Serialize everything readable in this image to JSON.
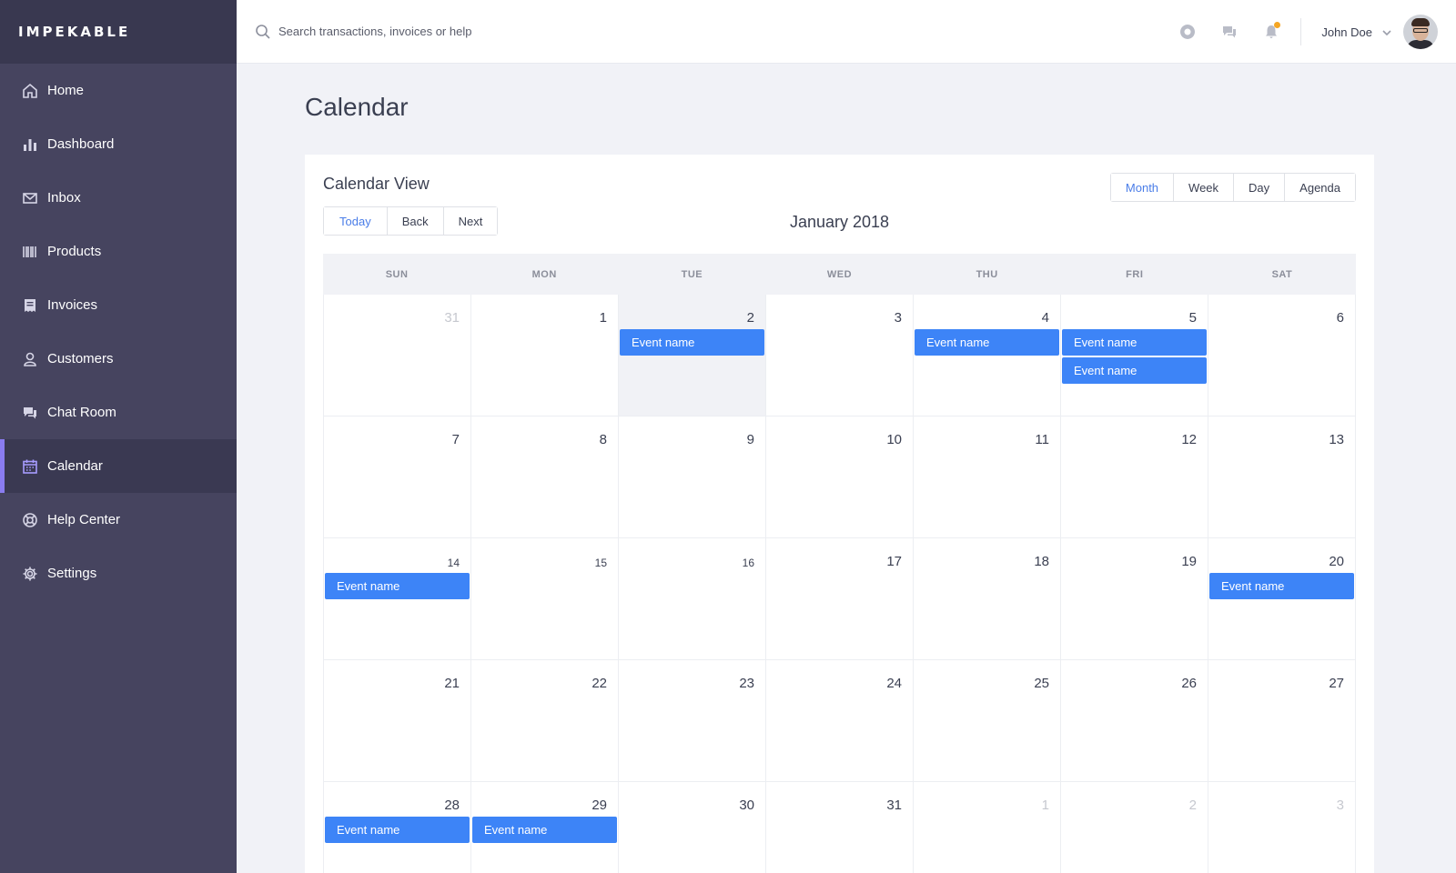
{
  "brand": "IMPEKABLE",
  "sidebar": {
    "items": [
      {
        "label": "Home"
      },
      {
        "label": "Dashboard"
      },
      {
        "label": "Inbox"
      },
      {
        "label": "Products"
      },
      {
        "label": "Invoices"
      },
      {
        "label": "Customers"
      },
      {
        "label": "Chat Room"
      },
      {
        "label": "Calendar",
        "active": true
      },
      {
        "label": "Help Center"
      },
      {
        "label": "Settings"
      }
    ]
  },
  "header": {
    "search_placeholder": "Search transactions, invoices or help",
    "user_name": "John Doe"
  },
  "page": {
    "title": "Calendar"
  },
  "calendar": {
    "card_title": "Calendar View",
    "nav_buttons": [
      "Today",
      "Back",
      "Next"
    ],
    "view_buttons": [
      "Month",
      "Week",
      "Day",
      "Agenda"
    ],
    "active_view": "Month",
    "month_label": "January 2018",
    "weekdays": [
      "SUN",
      "MON",
      "TUE",
      "WED",
      "THU",
      "FRI",
      "SAT"
    ],
    "weeks": [
      [
        {
          "day": "31",
          "off": true,
          "events": []
        },
        {
          "day": "1",
          "events": []
        },
        {
          "day": "2",
          "today": true,
          "events": [
            "Event name"
          ]
        },
        {
          "day": "3",
          "events": []
        },
        {
          "day": "4",
          "events": [
            "Event name"
          ]
        },
        {
          "day": "5",
          "events": [
            "Event name",
            "Event name"
          ]
        },
        {
          "day": "6",
          "events": []
        }
      ],
      [
        {
          "day": "7",
          "events": []
        },
        {
          "day": "8",
          "events": []
        },
        {
          "day": "9",
          "events": []
        },
        {
          "day": "10",
          "events": []
        },
        {
          "day": "11",
          "events": []
        },
        {
          "day": "12",
          "events": []
        },
        {
          "day": "13",
          "events": []
        }
      ],
      [
        {
          "day": "14",
          "small": true,
          "events": [
            "Event name"
          ]
        },
        {
          "day": "15",
          "small": true,
          "events": []
        },
        {
          "day": "16",
          "small": true,
          "events": []
        },
        {
          "day": "17",
          "events": []
        },
        {
          "day": "18",
          "events": []
        },
        {
          "day": "19",
          "events": []
        },
        {
          "day": "20",
          "events": [
            "Event name"
          ]
        }
      ],
      [
        {
          "day": "21",
          "events": []
        },
        {
          "day": "22",
          "events": []
        },
        {
          "day": "23",
          "events": []
        },
        {
          "day": "24",
          "events": []
        },
        {
          "day": "25",
          "events": []
        },
        {
          "day": "26",
          "events": []
        },
        {
          "day": "27",
          "events": []
        }
      ],
      [
        {
          "day": "28",
          "events": [
            "Event name"
          ]
        },
        {
          "day": "29",
          "events": [
            "Event name"
          ]
        },
        {
          "day": "30",
          "events": []
        },
        {
          "day": "31",
          "events": []
        },
        {
          "day": "1",
          "off": true,
          "events": []
        },
        {
          "day": "2",
          "off": true,
          "events": []
        },
        {
          "day": "3",
          "off": true,
          "events": []
        }
      ]
    ]
  },
  "colors": {
    "sidebar": "#46445f",
    "accent": "#8a7cf0",
    "event": "#3d84f7",
    "active_button_text": "#4a7de8",
    "notification_dot": "#f5a623"
  }
}
